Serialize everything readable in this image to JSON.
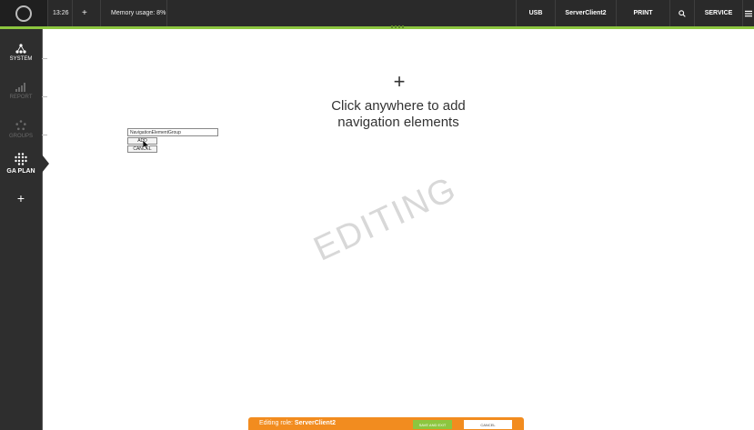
{
  "topbar": {
    "time": "13:26",
    "add": "+",
    "memory": "Memory usage: 8%",
    "usb": "USB",
    "server": "ServerClient2",
    "print": "PRINT",
    "search_icon": "search-icon",
    "service": "SERVICE",
    "menu_icon": "hamburger-icon"
  },
  "sidebar": {
    "items": [
      {
        "label": "SYSTEM",
        "icon": "network-icon"
      },
      {
        "label": "REPORT",
        "icon": "signal-bars-icon"
      },
      {
        "label": "GROUPS",
        "icon": "dots-ring-icon"
      },
      {
        "label": "GA PLAN",
        "icon": "dot-grid-icon"
      }
    ],
    "add": "+"
  },
  "main": {
    "hint_plus": "+",
    "hint_text": "Click anywhere to add navigation elements",
    "watermark": "EDITING",
    "input_value": "NavigationElementGroup",
    "add_button": "ADD",
    "cancel_button": "CANCEL"
  },
  "editbar": {
    "role_prefix": "Editing role:",
    "role_name": "ServerClient2",
    "save_exit": "SAVE AND EXIT",
    "cancel": "CANCEL"
  },
  "colors": {
    "accent_green": "#8cc63f",
    "accent_orange": "#f28c1f",
    "bar_dark": "#2a2a2a"
  }
}
